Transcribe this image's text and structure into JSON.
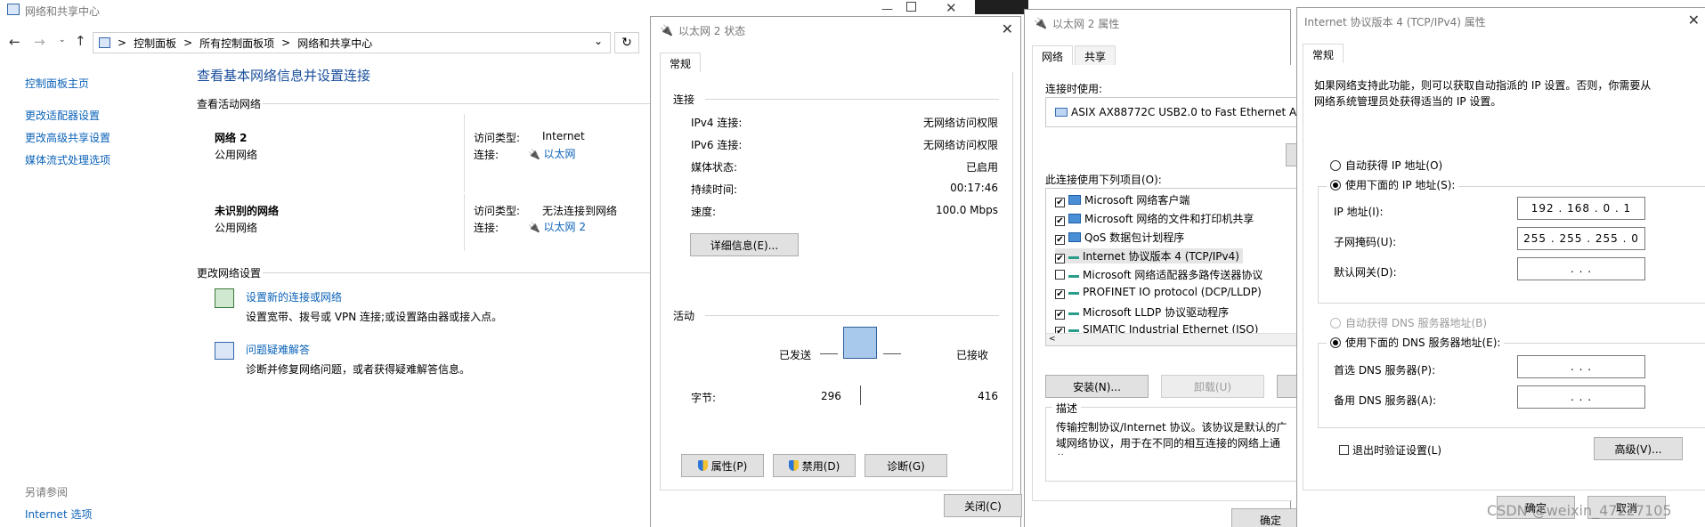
{
  "cp": {
    "title": "网络和共享中心",
    "breadcrumb": [
      "控制面板",
      "所有控制面板项",
      "网络和共享中心"
    ],
    "sep": ">",
    "sidebar": [
      "控制面板主页",
      "更改适配器设置",
      "更改高级共享设置",
      "媒体流式处理选项"
    ],
    "see_also_title": "另请参阅",
    "see_also": [
      "Internet 选项"
    ],
    "heading": "查看基本网络信息并设置连接",
    "active_label": "查看活动网络",
    "networks": [
      {
        "name": "网络 2",
        "type": "公用网络",
        "access_label": "访问类型:",
        "access": "Internet",
        "conn_label": "连接:",
        "conn": "以太网"
      },
      {
        "name": "未识别的网络",
        "type": "公用网络",
        "access_label": "访问类型:",
        "access": "无法连接到网络",
        "conn_label": "连接:",
        "conn": "以太网 2"
      }
    ],
    "change_label": "更改网络设置",
    "tasks": [
      {
        "title": "设置新的连接或网络",
        "desc": "设置宽带、拨号或 VPN 连接;或设置路由器或接入点。"
      },
      {
        "title": "问题疑难解答",
        "desc": "诊断并修复网络问题，或者获得疑难解答信息。"
      }
    ]
  },
  "status": {
    "title": "以太网 2 状态",
    "tab": "常规",
    "conn_group": "连接",
    "rows": [
      {
        "label": "IPv4 连接:",
        "value": "无网络访问权限"
      },
      {
        "label": "IPv6 连接:",
        "value": "无网络访问权限"
      },
      {
        "label": "媒体状态:",
        "value": "已启用"
      },
      {
        "label": "持续时间:",
        "value": "00:17:46"
      },
      {
        "label": "速度:",
        "value": "100.0 Mbps"
      }
    ],
    "details_button": "详细信息(E)...",
    "activity_group": "活动",
    "sent_label": "已发送",
    "recv_label": "已接收",
    "bytes_label": "字节:",
    "bytes_sent": "296",
    "bytes_recv": "416",
    "buttons": [
      "属性(P)",
      "禁用(D)",
      "诊断(G)"
    ],
    "close_button": "关闭(C)"
  },
  "props": {
    "title": "以太网 2 属性",
    "tabs": [
      "网络",
      "共享"
    ],
    "connect_using_label": "连接时使用:",
    "adapter": "ASIX AX88772C USB2.0 to Fast Ethernet Ac",
    "items_label": "此连接使用下列项目(O):",
    "items": [
      {
        "label": "Microsoft 网络客户端",
        "checked": true
      },
      {
        "label": "Microsoft 网络的文件和打印机共享",
        "checked": true
      },
      {
        "label": "QoS 数据包计划程序",
        "checked": true
      },
      {
        "label": "Internet 协议版本 4 (TCP/IPv4)",
        "checked": true
      },
      {
        "label": "Microsoft 网络适配器多路传送器协议",
        "checked": false
      },
      {
        "label": "PROFINET IO protocol (DCP/LLDP)",
        "checked": true
      },
      {
        "label": "Microsoft LLDP 协议驱动程序",
        "checked": true
      },
      {
        "label": "SIMATIC Industrial Ethernet (ISO)",
        "checked": true
      }
    ],
    "install_button": "安装(N)...",
    "uninstall_button": "卸载(U)",
    "desc_group": "描述",
    "desc": "传输控制协议/Internet 协议。该协议是默认的广域网络协议，用于在不同的相互连接的网络上通信。",
    "ok_button": "确定"
  },
  "ipv4": {
    "title": "Internet 协议版本 4 (TCP/IPv4) 属性",
    "tab": "常规",
    "intro": "如果网络支持此功能，则可以获取自动指派的 IP 设置。否则，你需要从网络系统管理员处获得适当的 IP 设置。",
    "auto_ip": "自动获得 IP 地址(O)",
    "manual_ip": "使用下面的 IP 地址(S):",
    "ip_label": "IP 地址(I):",
    "ip": "192 . 168 .  0  .  1",
    "mask_label": "子网掩码(U):",
    "mask": "255 . 255 . 255 .  0",
    "gw_label": "默认网关(D):",
    "gw": ".       .       .",
    "auto_dns": "自动获得 DNS 服务器地址(B)",
    "manual_dns": "使用下面的 DNS 服务器地址(E):",
    "dns1_label": "首选 DNS 服务器(P):",
    "dns1": ".       .       .",
    "dns2_label": "备用 DNS 服务器(A):",
    "dns2": ".       .       .",
    "validate": "退出时验证设置(L)",
    "advanced_button": "高级(V)...",
    "ok_button": "确定",
    "cancel_button": "取消"
  },
  "watermark": "CSDN @weixin_47227105"
}
